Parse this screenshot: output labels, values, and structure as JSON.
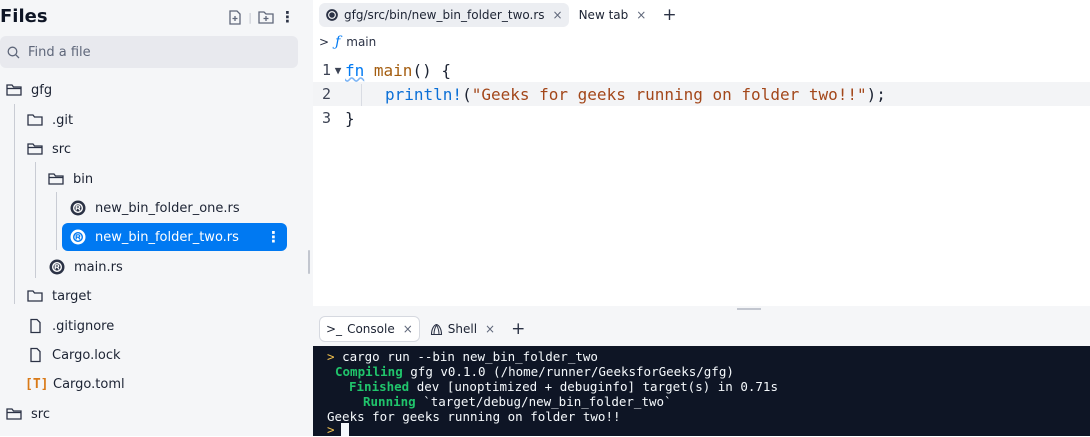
{
  "sidebar": {
    "title": "Files",
    "search_placeholder": "Find a file",
    "items": [
      {
        "label": "gfg"
      },
      {
        "label": ".git"
      },
      {
        "label": "src"
      },
      {
        "label": "bin"
      },
      {
        "label": "new_bin_folder_one.rs"
      },
      {
        "label": "new_bin_folder_two.rs"
      },
      {
        "label": "main.rs"
      },
      {
        "label": "target"
      },
      {
        "label": ".gitignore"
      },
      {
        "label": "Cargo.lock"
      },
      {
        "label": "Cargo.toml",
        "badge": "[T]"
      },
      {
        "label": "src"
      }
    ]
  },
  "editor": {
    "tabs": [
      {
        "label": "gfg/src/bin/new_bin_folder_two.rs",
        "close": "×"
      },
      {
        "label": "New tab",
        "close": "×"
      }
    ],
    "add_tab": "+",
    "breadcrumb": {
      "arrow": ">",
      "symbol": "ƒ",
      "name": "main"
    },
    "lines": [
      {
        "num": "1",
        "kw": "fn",
        "name": "main",
        "rest": "() {"
      },
      {
        "num": "2",
        "macro": "println!",
        "open": "(",
        "string": "\"Geeks for geeks running on folder two!!\"",
        "close": ");"
      },
      {
        "num": "3",
        "text": "}"
      }
    ]
  },
  "console": {
    "tabs": [
      {
        "label": "Console",
        "icon": ">_",
        "close": "×"
      },
      {
        "label": "Shell",
        "close": "×"
      }
    ],
    "add_tab": "+",
    "output": {
      "command_prompt": ">",
      "command": "cargo run --bin new_bin_folder_two",
      "compiling_label": "Compiling",
      "compiling_text": "gfg v0.1.0 (/home/runner/GeeksforGeeks/gfg)",
      "finished_label": "Finished",
      "finished_text": "dev [unoptimized + debuginfo] target(s) in 0.71s",
      "running_label": "Running",
      "running_text": "`target/debug/new_bin_folder_two`",
      "program_output": "Geeks for geeks running on folder two!!",
      "final_prompt": ">"
    }
  },
  "colors": {
    "accent": "#0079f2",
    "terminal_bg": "#0e1525",
    "status_green": "#20c46b",
    "toml": "#d97a18"
  }
}
